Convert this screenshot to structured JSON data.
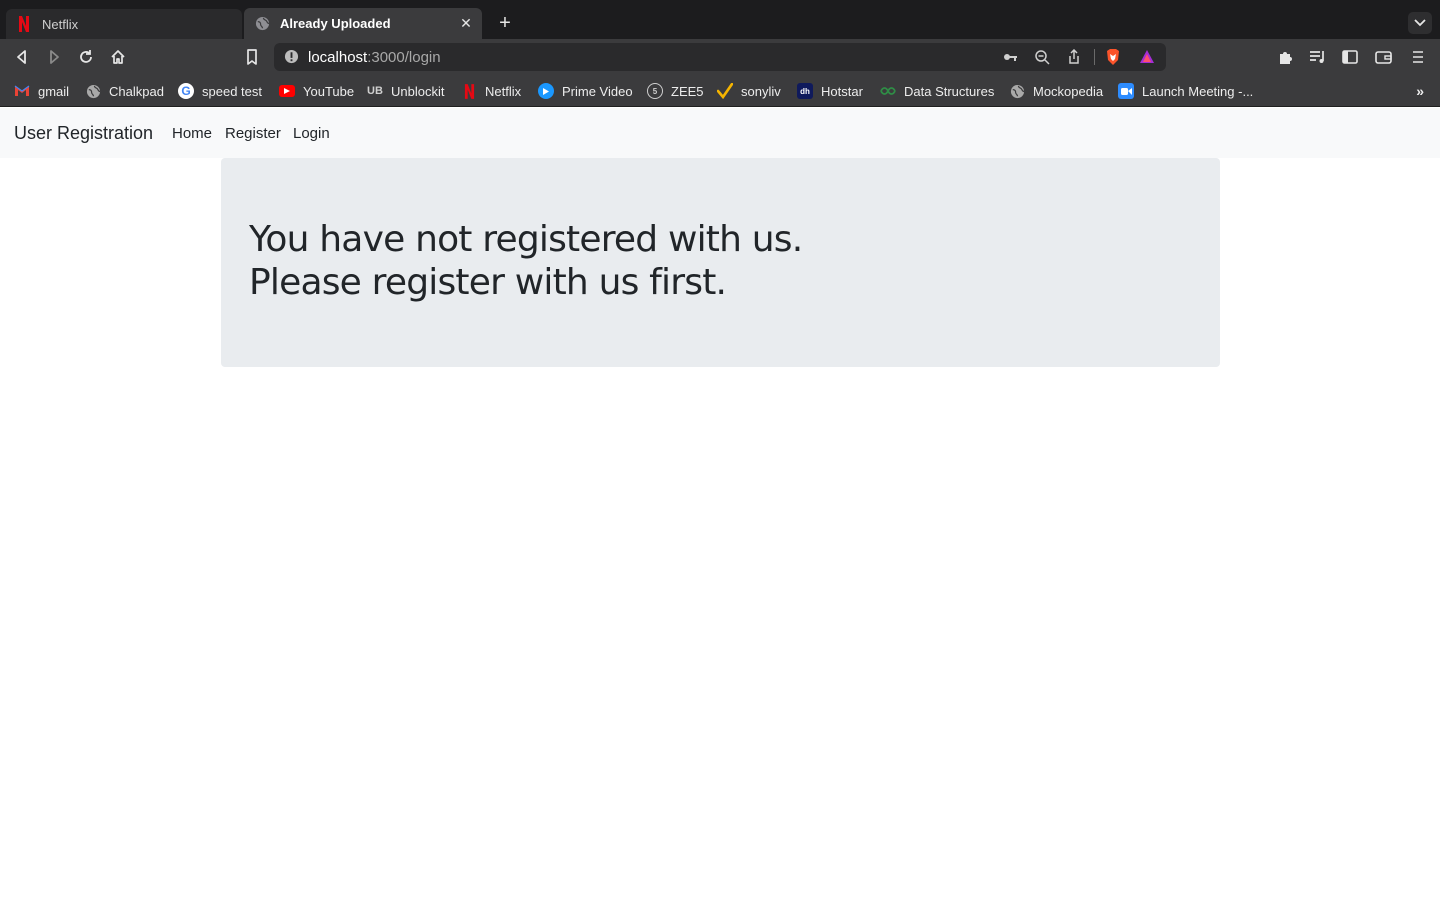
{
  "browser": {
    "tabs": [
      {
        "title": "Netflix",
        "active": false,
        "favicon": "netflix-icon"
      },
      {
        "title": "Already Uploaded",
        "active": true,
        "favicon": "globe-icon"
      }
    ],
    "address": {
      "host": "localhost",
      "path": ":3000/login"
    },
    "bookmarks": [
      {
        "label": "gmail",
        "icon": "gmail-icon"
      },
      {
        "label": "Chalkpad",
        "icon": "globe-icon"
      },
      {
        "label": "speed test",
        "icon": "google-icon"
      },
      {
        "label": "YouTube",
        "icon": "youtube-icon"
      },
      {
        "label": "Unblockit",
        "icon": "unblockit-icon"
      },
      {
        "label": "Netflix",
        "icon": "netflix-icon"
      },
      {
        "label": "Prime Video",
        "icon": "prime-video-icon"
      },
      {
        "label": "ZEE5",
        "icon": "zee5-icon"
      },
      {
        "label": "sonyliv",
        "icon": "sonyliv-icon"
      },
      {
        "label": "Hotstar",
        "icon": "hotstar-icon"
      },
      {
        "label": "Data Structures",
        "icon": "data-structures-icon"
      },
      {
        "label": "Mockopedia",
        "icon": "globe-icon"
      },
      {
        "label": "Launch Meeting -...",
        "icon": "zoom-icon"
      }
    ]
  },
  "navbar": {
    "brand": "User Registration",
    "links": [
      "Home",
      "Register",
      "Login"
    ]
  },
  "message": {
    "line1": "You have not registered with us.",
    "line2": "Please register with us first."
  }
}
